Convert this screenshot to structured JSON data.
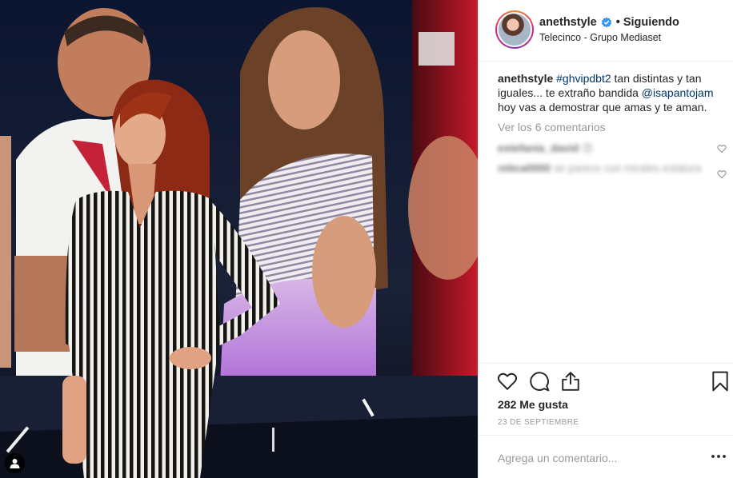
{
  "post": {
    "username": "anethstyle",
    "separator": "•",
    "follow_status": "Siguiendo",
    "location": "Telecinco - Grupo Mediaset"
  },
  "caption": {
    "username": "anethstyle",
    "hashtag": "#ghvipdbt2",
    "text_1": " tan distintas y tan iguales... te extraño bandida ",
    "mention": "@isapantojam",
    "text_2": " hoy vas a demostrar que amas y te aman."
  },
  "view_comments": "Ver los 6 comentarios",
  "comments": [
    {
      "username": "estefania_david",
      "text": "😍"
    },
    {
      "username": "rebca0000",
      "text": "se parece con mirales estatura"
    }
  ],
  "likes": "282 Me gusta",
  "date": "23 DE SEPTIEMBRE",
  "comment_placeholder": "Agrega un comentario...",
  "icons": {
    "verified": "verified-badge-icon",
    "like": "heart-icon",
    "comment": "comment-bubble-icon",
    "share": "share-icon",
    "save": "bookmark-icon",
    "more": "more-options-icon",
    "user_tag": "user-tag-icon"
  },
  "colors": {
    "link": "#003569",
    "verified": "#3897f0",
    "muted": "#999999"
  }
}
